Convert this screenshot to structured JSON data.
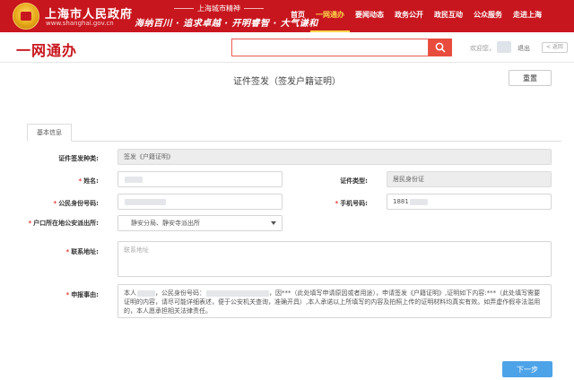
{
  "header": {
    "site_title": "上海市人民政府",
    "site_url": "www.shanghai.gov.cn",
    "slogan_top": "上海城市精神",
    "slogan": "海纳百川 · 追求卓越 · 开明睿智 · 大气谦和",
    "nav": [
      {
        "label": "首页"
      },
      {
        "label": "一网通办"
      },
      {
        "label": "要闻动态"
      },
      {
        "label": "政务公开"
      },
      {
        "label": "政民互动"
      },
      {
        "label": "公众服务"
      },
      {
        "label": "走进上海"
      }
    ],
    "active_nav": "一网通办"
  },
  "service_bar": {
    "brand": "一网通办",
    "search_placeholder": "",
    "welcome": "欢迎您，",
    "logout": "退出",
    "back": "< 返回"
  },
  "page": {
    "title": "证件签发（签发户籍证明）",
    "reset_label": "重置",
    "tab_label": "基本信息",
    "next_label": "下一步"
  },
  "form": {
    "cert_type_label": "证件签发种类:",
    "cert_type_value": "签发《户籍证明》",
    "name_label": "姓名:",
    "name_value": "",
    "id_type_label": "证件类型:",
    "id_type_value": "居民身份证",
    "id_number_label": "公民身份号码:",
    "id_number_value": "",
    "phone_label": "手机号码:",
    "phone_value": "1881",
    "police_station_label": "户口所在地公安派出所:",
    "police_station_value": "静安分局、静安寺派出所",
    "address_label": "联系地址:",
    "address_placeholder": "联系地址",
    "reason_label": "申报事由:",
    "reason_p1": "本人",
    "reason_p2": "，公民身份号码：",
    "reason_p3": "，因***（此处填写申请原因或者用途），申请签发《户籍证明》,证明如下内容:***（此处填写需要证明的内容，请尽可能详细表述，便于公安机关查询，准确开具）,本人承诺以上所填写的内容及拍照上传的证明材料均真实有效。如弄虚作假非法滥用的，本人愿承担相关法律责任。"
  },
  "colors": {
    "header_red": "#c8161e",
    "accent_yellow": "#ffd84d",
    "search_orange": "#e84c3d",
    "next_blue": "#4da3e8"
  }
}
